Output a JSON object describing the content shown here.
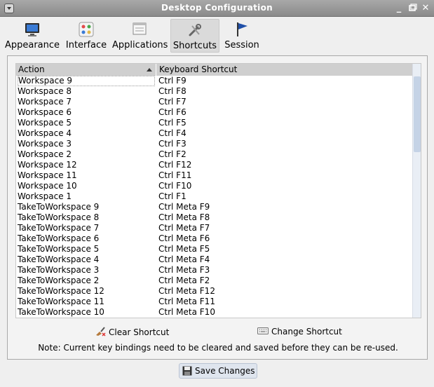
{
  "window": {
    "title": "Desktop Configuration"
  },
  "tabs": [
    {
      "label": "Appearance",
      "icon": "monitor-icon"
    },
    {
      "label": "Interface",
      "icon": "palette-icon"
    },
    {
      "label": "Applications",
      "icon": "windows-icon"
    },
    {
      "label": "Shortcuts",
      "icon": "tools-icon",
      "active": true
    },
    {
      "label": "Session",
      "icon": "flag-icon"
    }
  ],
  "table": {
    "columns": [
      "Action",
      "Keyboard Shortcut"
    ],
    "rows": [
      [
        "Workspace 9",
        "Ctrl F9"
      ],
      [
        "Workspace 8",
        "Ctrl F8"
      ],
      [
        "Workspace 7",
        "Ctrl F7"
      ],
      [
        "Workspace 6",
        "Ctrl F6"
      ],
      [
        "Workspace 5",
        "Ctrl F5"
      ],
      [
        "Workspace 4",
        "Ctrl F4"
      ],
      [
        "Workspace 3",
        "Ctrl F3"
      ],
      [
        "Workspace 2",
        "Ctrl F2"
      ],
      [
        "Workspace 12",
        "Ctrl F12"
      ],
      [
        "Workspace 11",
        "Ctrl F11"
      ],
      [
        "Workspace 10",
        "Ctrl F10"
      ],
      [
        "Workspace 1",
        "Ctrl F1"
      ],
      [
        "TakeToWorkspace 9",
        "Ctrl Meta F9"
      ],
      [
        "TakeToWorkspace 8",
        "Ctrl Meta F8"
      ],
      [
        "TakeToWorkspace 7",
        "Ctrl Meta F7"
      ],
      [
        "TakeToWorkspace 6",
        "Ctrl Meta F6"
      ],
      [
        "TakeToWorkspace 5",
        "Ctrl Meta F5"
      ],
      [
        "TakeToWorkspace 4",
        "Ctrl Meta F4"
      ],
      [
        "TakeToWorkspace 3",
        "Ctrl Meta F3"
      ],
      [
        "TakeToWorkspace 2",
        "Ctrl Meta F2"
      ],
      [
        "TakeToWorkspace 12",
        "Ctrl Meta F12"
      ],
      [
        "TakeToWorkspace 11",
        "Ctrl Meta F11"
      ],
      [
        "TakeToWorkspace 10",
        "Ctrl Meta F10"
      ]
    ]
  },
  "actions": {
    "clear_label": "Clear Shortcut",
    "change_label": "Change Shortcut"
  },
  "note": "Note: Current key bindings need to be cleared and saved before they can be re-used.",
  "save_label": "Save Changes"
}
